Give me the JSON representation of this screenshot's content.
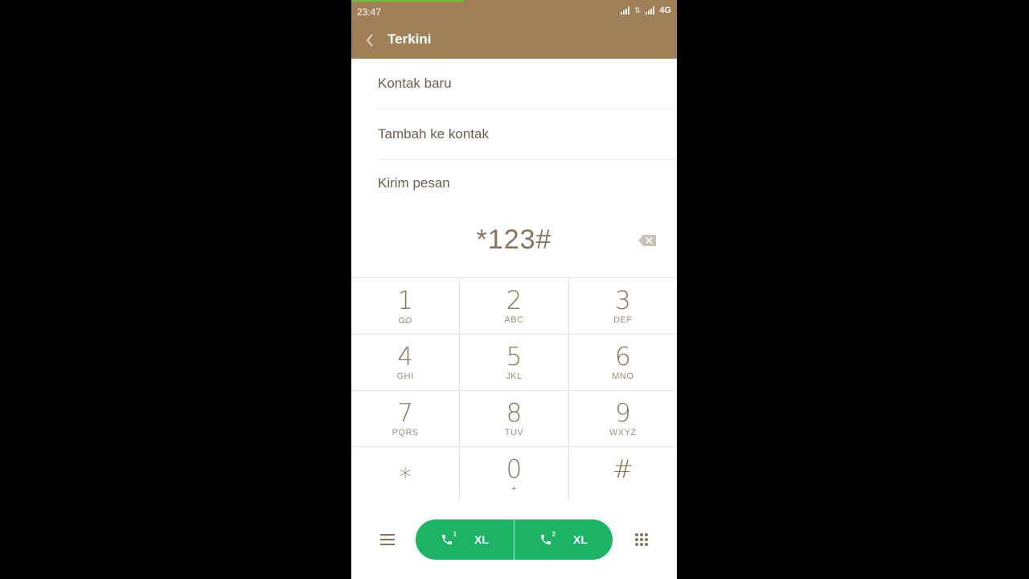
{
  "status_bar": {
    "time": "23:47",
    "network": "4G"
  },
  "app_bar": {
    "title": "Terkini"
  },
  "menu": {
    "items": [
      {
        "label": "Kontak baru"
      },
      {
        "label": "Tambah ke kontak"
      },
      {
        "label": "Kirim pesan"
      }
    ]
  },
  "dial": {
    "number": "*123#"
  },
  "keypad": {
    "keys": [
      {
        "digit": "1",
        "letters": ""
      },
      {
        "digit": "2",
        "letters": "ABC"
      },
      {
        "digit": "3",
        "letters": "DEF"
      },
      {
        "digit": "4",
        "letters": "GHI"
      },
      {
        "digit": "5",
        "letters": "JKL"
      },
      {
        "digit": "6",
        "letters": "MNO"
      },
      {
        "digit": "7",
        "letters": "PQRS"
      },
      {
        "digit": "8",
        "letters": "TUV"
      },
      {
        "digit": "9",
        "letters": "WXYZ"
      },
      {
        "digit": "⁎",
        "letters": ""
      },
      {
        "digit": "0",
        "letters": "+"
      },
      {
        "digit": "#",
        "letters": ""
      }
    ]
  },
  "call_buttons": [
    {
      "sim": "1",
      "carrier": "XL"
    },
    {
      "sim": "2",
      "carrier": "XL"
    }
  ],
  "colors": {
    "accent": "#a17f59",
    "call_green": "#1db364",
    "text": "#857560"
  },
  "icons": {
    "voicemail": "voicemail-icon",
    "backspace": "backspace-icon",
    "menu": "hamburger-icon",
    "dialpad": "dialpad-icon"
  }
}
